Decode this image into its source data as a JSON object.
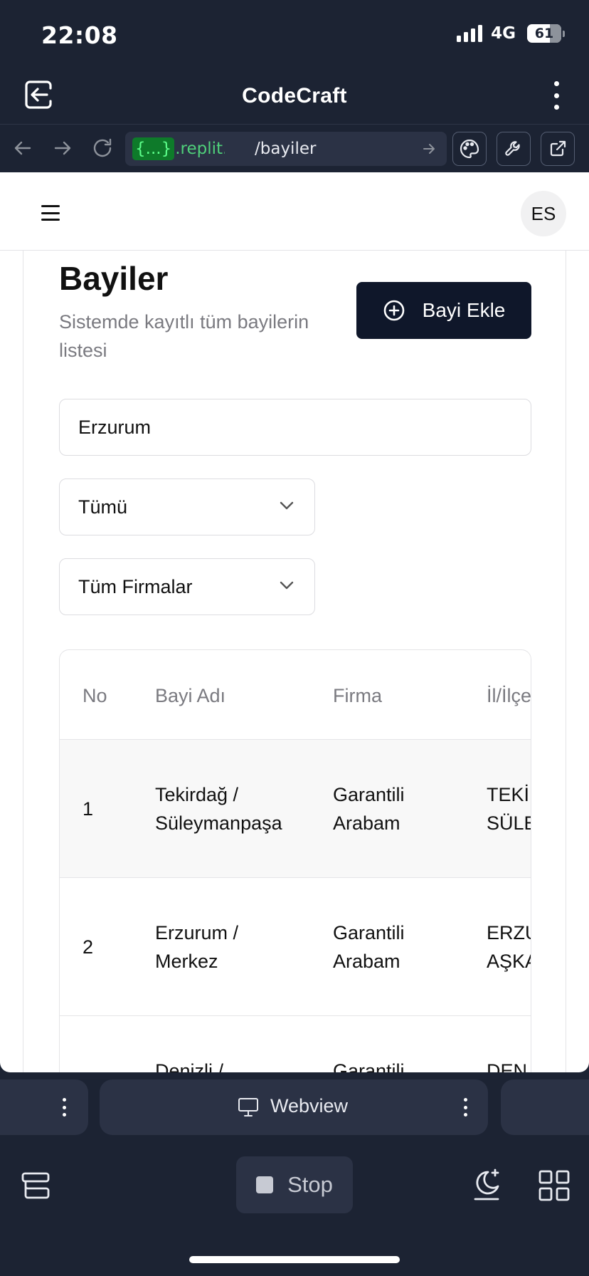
{
  "status": {
    "time": "22:08",
    "network": "4G",
    "battery": "61"
  },
  "app": {
    "title": "CodeCraft"
  },
  "url": {
    "badge": "{...}",
    "host": ".replit.dev",
    "path": "/bayiler"
  },
  "web": {
    "avatar": "ES",
    "title": "Bayiler",
    "subtitle": "Sistemde kayıtlı tüm bayilerin listesi",
    "add_button": "Bayi Ekle",
    "search_value": "Erzurum",
    "filter_status": "Tümü",
    "filter_company": "Tüm Firmalar",
    "table": {
      "headers": [
        "No",
        "Bayi Adı",
        "Firma",
        "İl/İlçe"
      ],
      "rows": [
        {
          "no": "1",
          "name1": "Tekirdağ /",
          "name2": "Süleymanpaşa",
          "firm1": "Garantili",
          "firm2": "Arabam",
          "loc1": "TEKİ",
          "loc2": "SÜLE"
        },
        {
          "no": "2",
          "name1": "Erzurum /",
          "name2": "Merkez",
          "firm1": "Garantili",
          "firm2": "Arabam",
          "loc1": "ERZU",
          "loc2": "AŞKA"
        },
        {
          "no": "",
          "name1": "Denizli /",
          "name2": "",
          "firm1": "Garantili",
          "firm2": "",
          "loc1": "DEN",
          "loc2": ""
        }
      ]
    }
  },
  "tabs": {
    "webview": "Webview"
  },
  "toolbar": {
    "stop": "Stop"
  },
  "colors": {
    "chrome_bg": "#1c2333",
    "accent_green": "#4fd07a",
    "primary_button": "#0f172a"
  }
}
